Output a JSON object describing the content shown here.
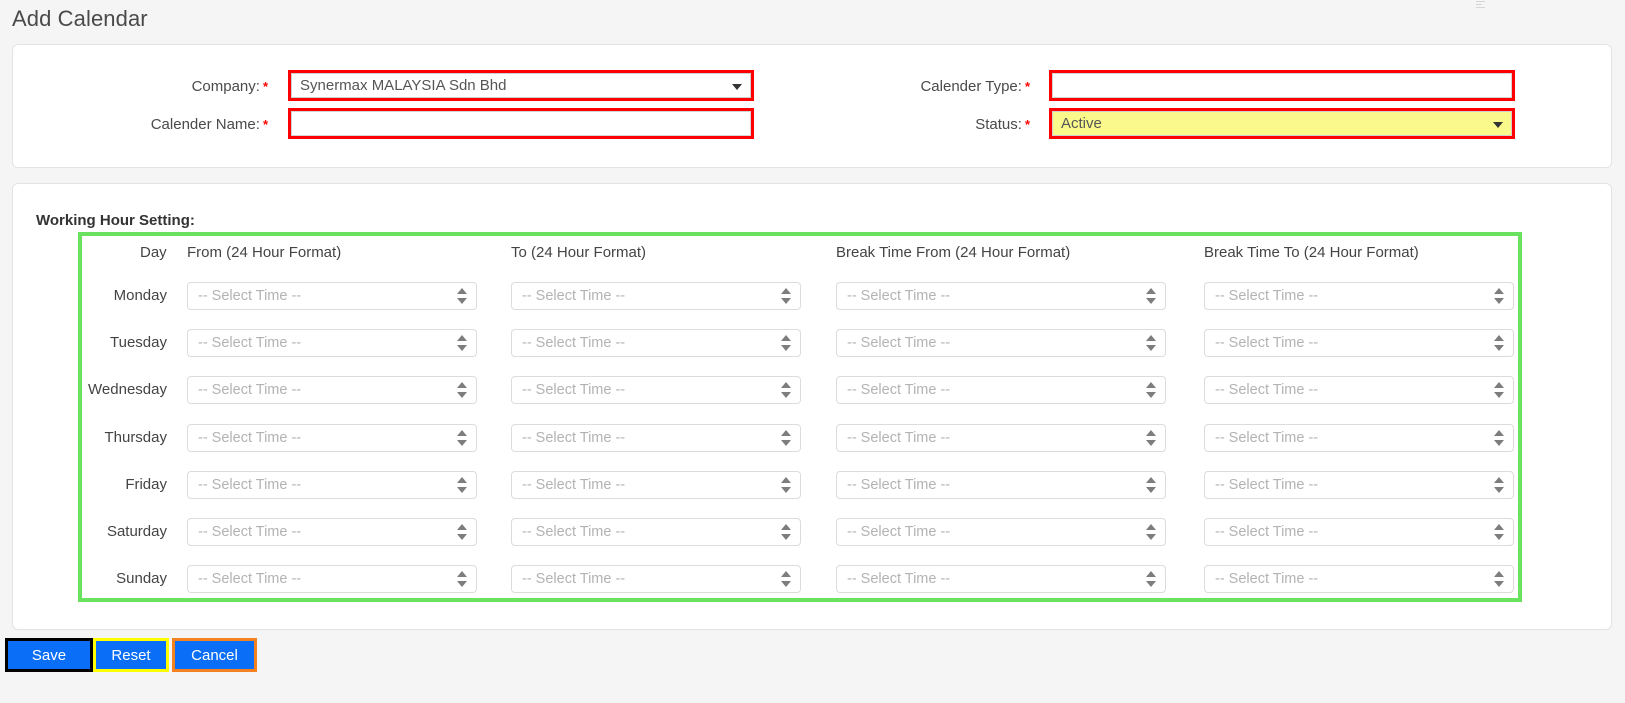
{
  "page": {
    "title": "Add Calendar",
    "background_color": "#f5f5f5"
  },
  "colors": {
    "highlight_red": "#ff0000",
    "highlight_green": "#6ae25f",
    "highlight_yellow_bg": "#fafa8c",
    "button_blue": "#0b6ef6",
    "save_outline": "#000000",
    "reset_outline": "#ffff00",
    "cancel_outline": "#f58220"
  },
  "form": {
    "fields": [
      {
        "label": "Company:",
        "required_marker": "*",
        "type": "select",
        "value": "Synermax MALAYSIA Sdn Bhd",
        "highlight": "red"
      },
      {
        "label": "Calender Name:",
        "required_marker": "*",
        "type": "text",
        "value": "",
        "placeholder": "",
        "highlight": "red"
      },
      {
        "label": "Calender Type:",
        "required_marker": "*",
        "type": "text",
        "value": "",
        "placeholder": "",
        "highlight": "red"
      },
      {
        "label": "Status:",
        "required_marker": "*",
        "type": "select",
        "value": "Active",
        "highlight": "red",
        "background": "yellow"
      }
    ]
  },
  "working_hours": {
    "section_title": "Working Hour Setting:",
    "columns": [
      "Day",
      "From (24 Hour Format)",
      "To (24 Hour Format)",
      "Break Time From (24 Hour Format)",
      "Break Time To (24 Hour Format)"
    ],
    "placeholder": "-- Select Time --",
    "rows": [
      {
        "day": "Monday",
        "from": "",
        "to": "",
        "break_from": "",
        "break_to": ""
      },
      {
        "day": "Tuesday",
        "from": "",
        "to": "",
        "break_from": "",
        "break_to": ""
      },
      {
        "day": "Wednesday",
        "from": "",
        "to": "",
        "break_from": "",
        "break_to": ""
      },
      {
        "day": "Thursday",
        "from": "",
        "to": "",
        "break_from": "",
        "break_to": ""
      },
      {
        "day": "Friday",
        "from": "",
        "to": "",
        "break_from": "",
        "break_to": ""
      },
      {
        "day": "Saturday",
        "from": "",
        "to": "",
        "break_from": "",
        "break_to": ""
      },
      {
        "day": "Sunday",
        "from": "",
        "to": "",
        "break_from": "",
        "break_to": ""
      }
    ]
  },
  "actions": {
    "save_label": "Save",
    "reset_label": "Reset",
    "cancel_label": "Cancel"
  }
}
